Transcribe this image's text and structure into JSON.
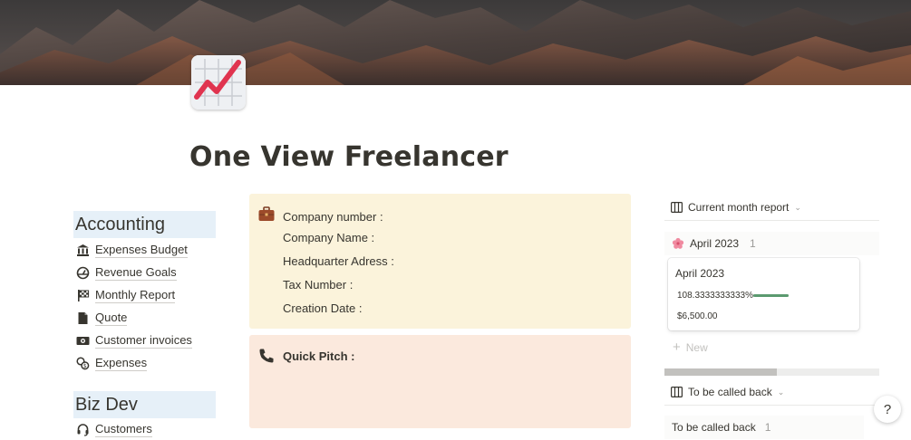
{
  "page": {
    "title": "One View Freelancer"
  },
  "sidebar": {
    "accounting": {
      "heading": "Accounting",
      "items": [
        {
          "label": "Expenses Budget",
          "icon": "bank-icon"
        },
        {
          "label": "Revenue Goals",
          "icon": "gauge-icon"
        },
        {
          "label": "Monthly Report",
          "icon": "flag-icon"
        },
        {
          "label": "Quote",
          "icon": "document-icon"
        },
        {
          "label": "Customer invoices",
          "icon": "money-icon"
        },
        {
          "label": "Expenses",
          "icon": "coins-icon"
        }
      ]
    },
    "bizdev": {
      "heading": "Biz Dev",
      "items": [
        {
          "label": "Customers",
          "icon": "headset-icon"
        }
      ]
    }
  },
  "company": {
    "icon": "briefcase-icon",
    "fields": [
      "Company number :",
      "Company Name :",
      "Headquarter Adress :",
      "Tax Number :",
      "Creation Date :"
    ]
  },
  "pitch": {
    "icon": "phone-icon",
    "label": "Quick Pitch :"
  },
  "report_view": {
    "title": "Current month report",
    "group": {
      "name": "April 2023",
      "count": "1"
    },
    "card": {
      "title": "April 2023",
      "percent": "108.3333333333%",
      "progress": 1.0,
      "amount": "$6,500.00"
    },
    "new_label": "New"
  },
  "callback_view": {
    "title": "To be called back",
    "group": {
      "name": "To be called back",
      "count": "1"
    }
  },
  "help": {
    "label": "?"
  },
  "colors": {
    "accent_heading_bg": "#e6f0f8",
    "info_callout_bg": "#fbf3db",
    "pitch_callout_bg": "#fbe9dd",
    "progress_green": "#5b9a6f"
  }
}
